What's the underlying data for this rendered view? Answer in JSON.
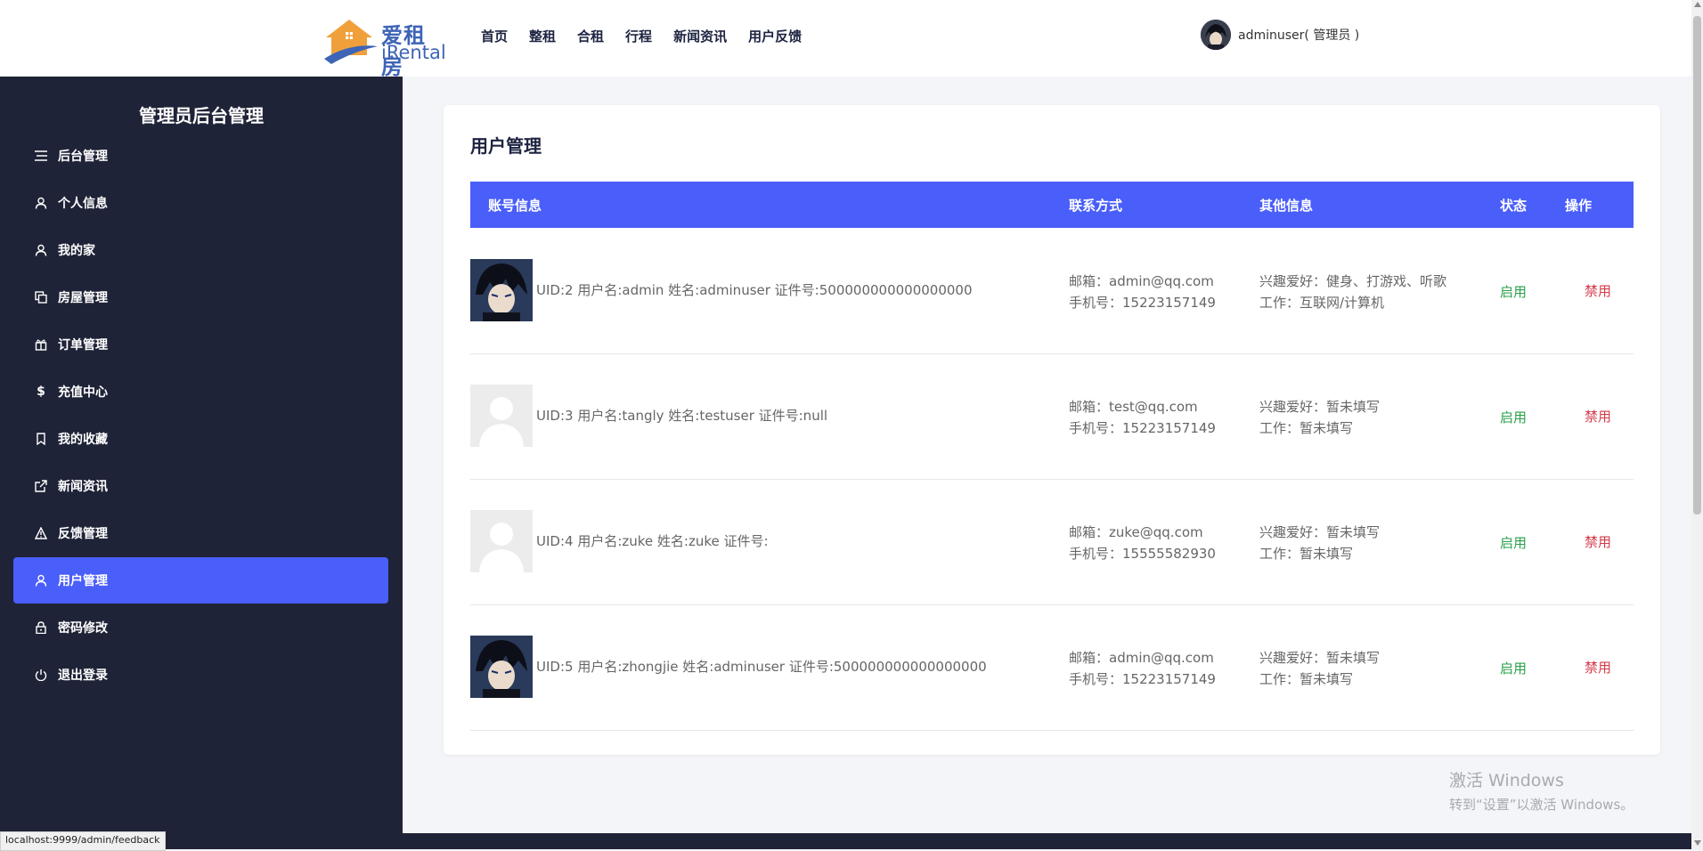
{
  "header": {
    "logo_cn": "爱租房",
    "logo_en": "iRental",
    "nav": [
      "首页",
      "整租",
      "合租",
      "行程",
      "新闻资讯",
      "用户反馈"
    ],
    "user_name": "adminuser( 管理员 )"
  },
  "sidebar": {
    "title": "管理员后台管理",
    "items": [
      {
        "label": "后台管理",
        "icon": "menu-lines-icon"
      },
      {
        "label": "个人信息",
        "icon": "user-icon"
      },
      {
        "label": "我的家",
        "icon": "user-icon"
      },
      {
        "label": "房屋管理",
        "icon": "copy-icon"
      },
      {
        "label": "订单管理",
        "icon": "gift-icon"
      },
      {
        "label": "充值中心",
        "icon": "dollar-icon"
      },
      {
        "label": "我的收藏",
        "icon": "bookmark-icon"
      },
      {
        "label": "新闻资讯",
        "icon": "external-link-icon"
      },
      {
        "label": "反馈管理",
        "icon": "warning-icon"
      },
      {
        "label": "用户管理",
        "icon": "user-icon",
        "active": true
      },
      {
        "label": "密码修改",
        "icon": "lock-icon"
      },
      {
        "label": "退出登录",
        "icon": "power-icon"
      }
    ]
  },
  "main": {
    "title": "用户管理",
    "columns": [
      "账号信息",
      "联系方式",
      "其他信息",
      "状态",
      "操作"
    ],
    "rows": [
      {
        "avatar": "anime-avatar",
        "account": "UID:2 用户名:admin 姓名:adminuser 证件号:500000000000000000",
        "email": "邮箱：admin@qq.com",
        "phone": "手机号：15223157149",
        "hobby": "兴趣爱好：健身、打游戏、听歌",
        "job": "工作：互联网/计算机",
        "status": "启用",
        "action": "禁用"
      },
      {
        "avatar": "default-avatar",
        "account": "UID:3 用户名:tangly 姓名:testuser 证件号:null",
        "email": "邮箱：test@qq.com",
        "phone": "手机号：15223157149",
        "hobby": "兴趣爱好：暂未填写",
        "job": "工作：暂未填写",
        "status": "启用",
        "action": "禁用"
      },
      {
        "avatar": "default-avatar",
        "account": "UID:4 用户名:zuke 姓名:zuke 证件号:",
        "email": "邮箱：zuke@qq.com",
        "phone": "手机号：15555582930",
        "hobby": "兴趣爱好：暂未填写",
        "job": "工作：暂未填写",
        "status": "启用",
        "action": "禁用"
      },
      {
        "avatar": "anime-avatar",
        "account": "UID:5 用户名:zhongjie 姓名:adminuser 证件号:500000000000000000",
        "email": "邮箱：admin@qq.com",
        "phone": "手机号：15223157149",
        "hobby": "兴趣爱好：暂未填写",
        "job": "工作：暂未填写",
        "status": "启用",
        "action": "禁用"
      }
    ]
  },
  "status_bar": {
    "url": "localhost:9999/admin/feedback"
  },
  "watermark": {
    "line1": "激活 Windows",
    "line2": "转到“设置”以激活 Windows。"
  },
  "colors": {
    "accent": "#4a5ef9",
    "sidebar_bg": "#1f2337",
    "enabled": "#2aa04a",
    "disable": "#d43a4a"
  }
}
